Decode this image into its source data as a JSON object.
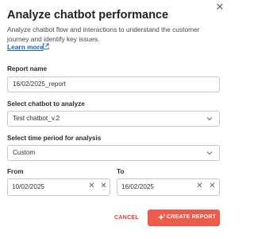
{
  "dialog": {
    "title": "Analyze chatbot performance",
    "description": "Analyze chatbot flow and interactions to understand the customer journey and identify key issues.",
    "learn_more": "Learn more",
    "close_icon": "close-icon"
  },
  "form": {
    "report_name_label": "Report name",
    "report_name_value": "16/02/2025_report",
    "chatbot_label": "Select chatbot to analyze",
    "chatbot_value": "Test chatbot_v.2",
    "period_label": "Select time period for analysis",
    "period_value": "Custom",
    "from_label": "From",
    "from_value": "10/02/2025",
    "to_label": "To",
    "to_value": "16/02/2025"
  },
  "actions": {
    "cancel_label": "CANCEL",
    "create_label": "CREATE REPORT"
  },
  "colors": {
    "accent": "#ee5b4c",
    "link": "#1763d6"
  }
}
